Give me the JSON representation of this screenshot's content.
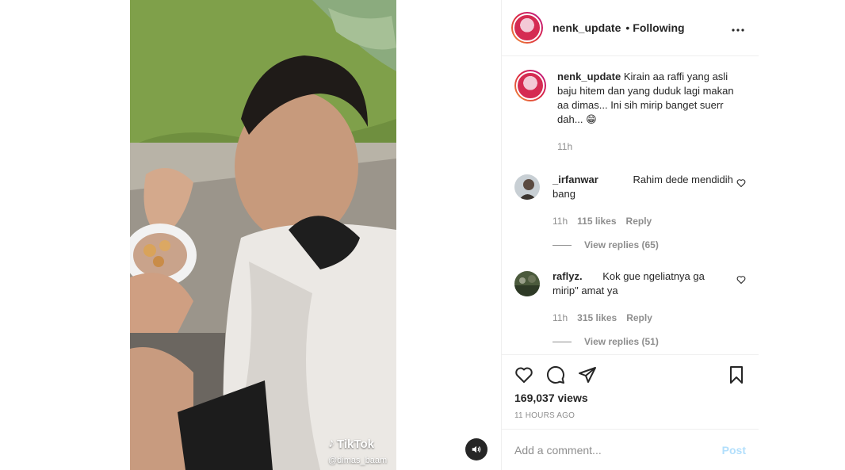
{
  "post": {
    "account": "nenk_update",
    "dot": "•",
    "follow_state": "Following",
    "more_icon": "more-horizontal-icon",
    "caption_text": "Kirain aa raffi yang asli baju hitem dan yang duduk lagi makan aa dimas... Ini sih mirip banget suerr dah...",
    "caption_emoji": "😁",
    "caption_time": "11h"
  },
  "video": {
    "watermark": "TikTok",
    "watermark_handle": "@dimas_baam",
    "mute_icon": "volume-icon"
  },
  "comments": [
    {
      "user": "_irfanwar",
      "text": "Rahim dede mendidih bang",
      "time": "11h",
      "likes": "115 likes",
      "reply": "Reply",
      "view_replies": "View replies (65)"
    },
    {
      "user": "raflyz.",
      "text": "Kok gue ngeliatnya ga mirip\" amat ya",
      "time": "11h",
      "likes": "315 likes",
      "reply": "Reply",
      "view_replies": "View replies (51)"
    }
  ],
  "stats": {
    "views": "169,037 views",
    "posted": "11 HOURS AGO"
  },
  "composer": {
    "placeholder": "Add a comment...",
    "post_label": "Post"
  },
  "colors": {
    "link_blue_disabled": "#b2dffc",
    "muted_text": "#8e8e8e",
    "text": "#262626"
  }
}
